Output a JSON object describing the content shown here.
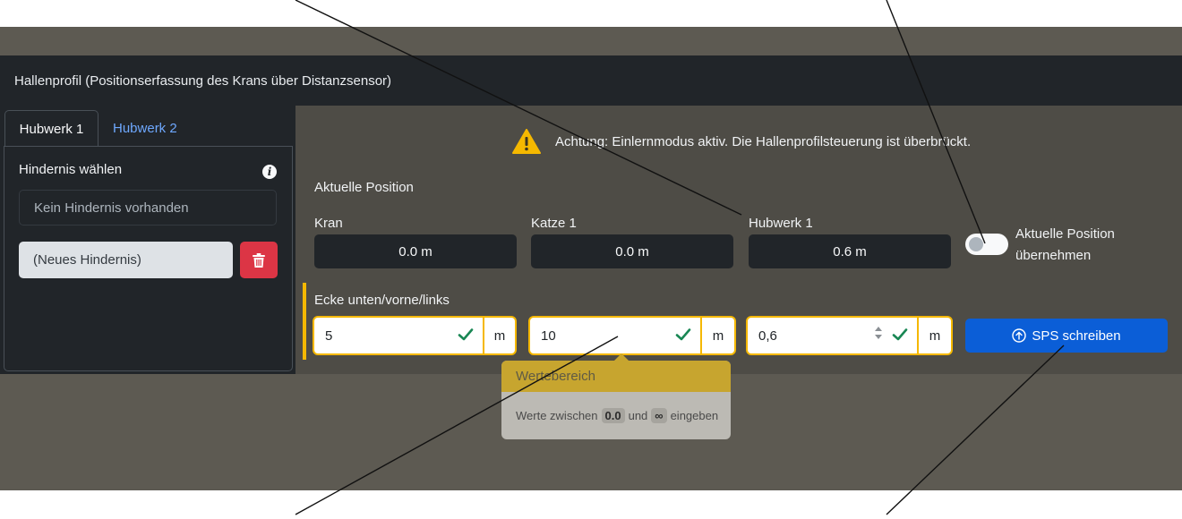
{
  "header": {
    "title": "Hallenprofil (Positionserfassung des Krans über Distanzsensor)"
  },
  "tabs": [
    {
      "label": "Hubwerk 1",
      "active": true
    },
    {
      "label": "Hubwerk 2",
      "active": false
    }
  ],
  "sidebar": {
    "title": "Hindernis wählen",
    "info_icon": "info-icon",
    "no_obstacle": "Kein Hindernis vorhanden",
    "new_obstacle": "(Neues Hindernis)",
    "delete_icon": "trash-icon"
  },
  "warning": {
    "icon": "warning-icon",
    "text": "Achtung: Einlernmodus aktiv. Die Hallenprofilsteuerung ist überbrückt."
  },
  "position": {
    "title": "Aktuelle Position",
    "fields": [
      {
        "label": "Kran",
        "value": "0.0 m"
      },
      {
        "label": "Katze 1",
        "value": "0.0 m"
      },
      {
        "label": "Hubwerk 1",
        "value": "0.6 m"
      }
    ]
  },
  "toggle": {
    "label_line1": "Aktuelle Position",
    "label_line2": "übernehmen",
    "on": false
  },
  "corner": {
    "title": "Ecke unten/vorne/links",
    "inputs": [
      {
        "value": "5",
        "unit": "m"
      },
      {
        "value": "10",
        "unit": "m"
      },
      {
        "value": "0,6",
        "unit": "m"
      }
    ]
  },
  "sps_button": {
    "label": "SPS schreiben",
    "icon": "arrow-up-circle-icon"
  },
  "tooltip": {
    "title": "Wertebereich",
    "prefix": "Werte zwischen",
    "min": "0.0",
    "connector": "und",
    "max": "∞",
    "suffix": "eingeben"
  },
  "colors": {
    "accent": "#f5b800",
    "primary": "#0b5ed7",
    "danger": "#dc3545",
    "success": "#198754",
    "link": "#6ea8fe"
  }
}
